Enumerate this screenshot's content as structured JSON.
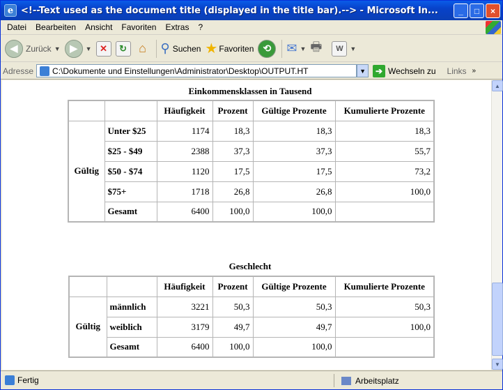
{
  "window": {
    "title": "<!--Text used as the document title (displayed in the title bar).--> - Microsoft In...",
    "buttons": {
      "minimize": "_",
      "maximize": "□",
      "close": "×"
    }
  },
  "menu": [
    "Datei",
    "Bearbeiten",
    "Ansicht",
    "Favoriten",
    "Extras",
    "?"
  ],
  "toolbar": {
    "back_label": "Zurück",
    "search_label": "Suchen",
    "favorites_label": "Favoriten"
  },
  "address": {
    "label": "Adresse",
    "value": "C:\\Dokumente und Einstellungen\\Administrator\\Desktop\\OUTPUT.HT",
    "go_label": "Wechseln zu",
    "links_label": "Links"
  },
  "status": {
    "left": "Fertig",
    "right": "Arbeitsplatz"
  },
  "tables": [
    {
      "caption": "Einkommensklassen in Tausend",
      "headers": [
        "",
        "",
        "Häufigkeit",
        "Prozent",
        "Gültige Prozente",
        "Kumulierte Prozente"
      ],
      "group_label": "Gültig",
      "rows": [
        {
          "label": "Unter $25",
          "freq": "1174",
          "pct": "18,3",
          "valid": "18,3",
          "cum": "18,3"
        },
        {
          "label": "$25 - $49",
          "freq": "2388",
          "pct": "37,3",
          "valid": "37,3",
          "cum": "55,7"
        },
        {
          "label": "$50 - $74",
          "freq": "1120",
          "pct": "17,5",
          "valid": "17,5",
          "cum": "73,2"
        },
        {
          "label": "$75+",
          "freq": "1718",
          "pct": "26,8",
          "valid": "26,8",
          "cum": "100,0"
        },
        {
          "label": "Gesamt",
          "freq": "6400",
          "pct": "100,0",
          "valid": "100,0",
          "cum": ""
        }
      ]
    },
    {
      "caption": "Geschlecht",
      "headers": [
        "",
        "",
        "Häufigkeit",
        "Prozent",
        "Gültige Prozente",
        "Kumulierte Prozente"
      ],
      "group_label": "Gültig",
      "rows": [
        {
          "label": "männlich",
          "freq": "3221",
          "pct": "50,3",
          "valid": "50,3",
          "cum": "50,3"
        },
        {
          "label": "weiblich",
          "freq": "3179",
          "pct": "49,7",
          "valid": "49,7",
          "cum": "100,0"
        },
        {
          "label": "Gesamt",
          "freq": "6400",
          "pct": "100,0",
          "valid": "100,0",
          "cum": ""
        }
      ]
    }
  ]
}
